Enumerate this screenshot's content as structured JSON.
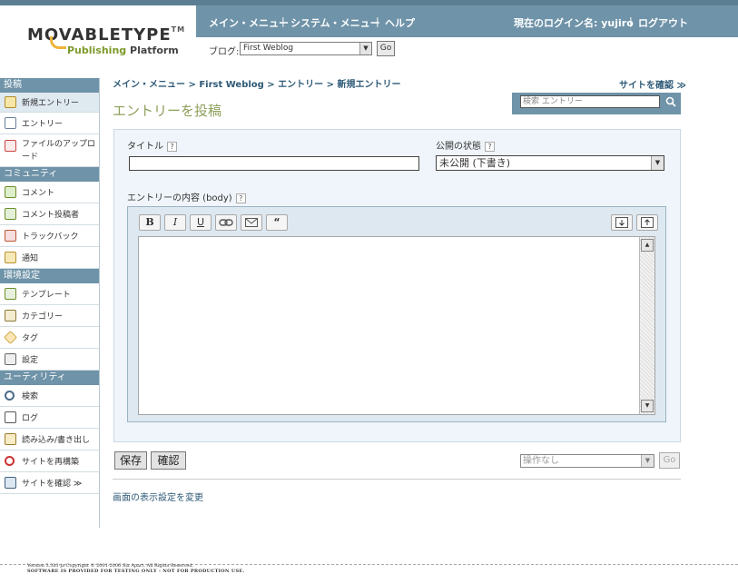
{
  "header": {
    "logo_main": "MOVABLETYPE",
    "logo_tm": "TM",
    "logo_sub_a": "Publishing",
    "logo_sub_b": "Platform",
    "nav": {
      "main_menu": "メイン・メニュー",
      "system_menu": "システム・メニュー",
      "help": "ヘルプ",
      "login_label": "現在のログイン名: yujiro",
      "logout": "ログアウト",
      "sep": "|"
    },
    "blog_label": "ブログ:",
    "blog_selected": "First Weblog",
    "blog_go": "Go"
  },
  "sidebar": {
    "sections": [
      {
        "title": "投稿",
        "items": [
          "新規エントリー",
          "エントリー",
          "ファイルのアップロード"
        ]
      },
      {
        "title": "コミュニティ",
        "items": [
          "コメント",
          "コメント投稿者",
          "トラックバック",
          "通知"
        ]
      },
      {
        "title": "環境設定",
        "items": [
          "テンプレート",
          "カテゴリー",
          "タグ",
          "設定"
        ]
      },
      {
        "title": "ユーティリティ",
        "items": [
          "検索",
          "ログ",
          "読み込み/書き出し",
          "サイトを再構築",
          "サイトを確認 ≫"
        ]
      }
    ]
  },
  "main": {
    "breadcrumb": "メイン・メニュー > First Weblog > エントリー > 新規エントリー",
    "view_site": "サイトを確認 ≫",
    "page_title": "エントリーを投稿",
    "search_placeholder": "検索 エントリー",
    "form": {
      "title_label": "タイトル",
      "title_value": "",
      "status_label": "公開の状態",
      "status_selected": "未公開 (下書き)",
      "body_label": "エントリーの内容 (body)",
      "help_mark": "?",
      "toolbar": [
        "B",
        "I",
        "U",
        "link",
        "email",
        "quote"
      ]
    },
    "save_button": "保存",
    "preview_button": "確認",
    "action_select": "操作なし",
    "action_go": "Go",
    "display_settings": "画面の表示設定を変更"
  },
  "footer": {
    "line1": "Version 3.3b1-ja Copyright © 2001-2006 Six Apart. All Rights Reserved.",
    "line2": "SOFTWARE IS PROVIDED FOR TESTING ONLY - NOT FOR PRODUCTION USE."
  },
  "colors": {
    "nav_blue": "#6f93a8",
    "title_green": "#8da05a",
    "link_blue": "#2e5a77",
    "panel_bg": "#eff5fa"
  }
}
